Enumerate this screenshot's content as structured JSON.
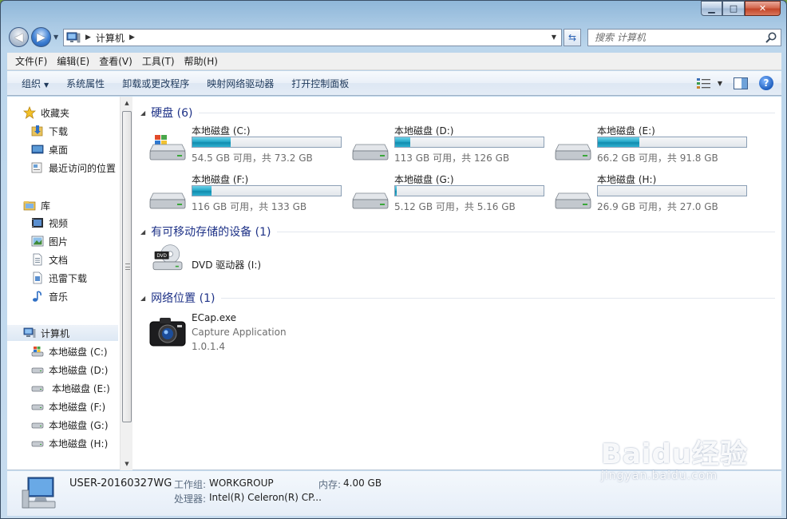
{
  "window": {
    "caption": {
      "minimize": "▁",
      "maximize": "□",
      "close": "✕"
    }
  },
  "address_bar": {
    "path": "计算机",
    "search_placeholder": "搜索 计算机"
  },
  "menu": [
    "文件(F)",
    "编辑(E)",
    "查看(V)",
    "工具(T)",
    "帮助(H)"
  ],
  "toolbar": {
    "organize": "组织",
    "commands": [
      "系统属性",
      "卸载或更改程序",
      "映射网络驱动器",
      "打开控制面板"
    ]
  },
  "nav_pane": {
    "favorites_label": "收藏夹",
    "favorites": [
      {
        "label": "下载",
        "icon": "download-folder-icon"
      },
      {
        "label": "桌面",
        "icon": "desktop-icon"
      },
      {
        "label": "最近访问的位置",
        "icon": "recent-places-icon"
      }
    ],
    "libraries_label": "库",
    "libraries": [
      {
        "label": "视频",
        "icon": "video-library-icon"
      },
      {
        "label": "图片",
        "icon": "picture-library-icon"
      },
      {
        "label": "文档",
        "icon": "document-library-icon"
      },
      {
        "label": "迅雷下载",
        "icon": "thunder-download-icon"
      },
      {
        "label": "音乐",
        "icon": "music-library-icon"
      }
    ],
    "computer_label": "计算机",
    "drives": [
      {
        "label": "本地磁盘 (C:)",
        "icon": "windows-drive-icon"
      },
      {
        "label": "本地磁盘 (D:)",
        "icon": "hard-drive-icon"
      },
      {
        "label": "本地磁盘 (E:)",
        "icon": "hard-drive-icon"
      },
      {
        "label": "本地磁盘 (F:)",
        "icon": "hard-drive-icon"
      },
      {
        "label": "本地磁盘 (G:)",
        "icon": "hard-drive-icon"
      },
      {
        "label": "本地磁盘 (H:)",
        "icon": "hard-drive-icon"
      }
    ]
  },
  "groups": {
    "hard_disks": {
      "title": "硬盘 (6)",
      "items": [
        {
          "name": "本地磁盘 (C:)",
          "size_text": "54.5 GB 可用，共 73.2 GB",
          "used_fraction": 0.26,
          "os": true
        },
        {
          "name": "本地磁盘 (D:)",
          "size_text": "113 GB 可用，共 126 GB",
          "used_fraction": 0.1,
          "os": false
        },
        {
          "name": "本地磁盘 (E:)",
          "size_text": "66.2 GB 可用，共 91.8 GB",
          "used_fraction": 0.28,
          "os": false
        },
        {
          "name": "本地磁盘 (F:)",
          "size_text": "116 GB 可用，共 133 GB",
          "used_fraction": 0.13,
          "os": false
        },
        {
          "name": "本地磁盘 (G:)",
          "size_text": "5.12 GB 可用，共 5.16 GB",
          "used_fraction": 0.01,
          "os": false
        },
        {
          "name": "本地磁盘 (H:)",
          "size_text": "26.9 GB 可用，共 27.0 GB",
          "used_fraction": 0.0,
          "os": false
        }
      ]
    },
    "removable": {
      "title": "有可移动存储的设备 (1)",
      "items": [
        {
          "name": "DVD 驱动器 (I:)",
          "icon_text": "DVD"
        }
      ]
    },
    "network": {
      "title": "网络位置 (1)",
      "items": [
        {
          "name": "ECap.exe",
          "description": "Capture Application",
          "version": "1.0.1.4"
        }
      ]
    }
  },
  "details": {
    "computer_name": "USER-20160327WG",
    "workgroup_label": "工作组:",
    "workgroup": "WORKGROUP",
    "memory_label": "内存:",
    "memory": "4.00 GB",
    "processor_label": "处理器:",
    "processor": "Intel(R) Celeron(R) CP..."
  },
  "watermark": {
    "brand": "Baidu经验",
    "url": "jingyan.baidu.com"
  }
}
